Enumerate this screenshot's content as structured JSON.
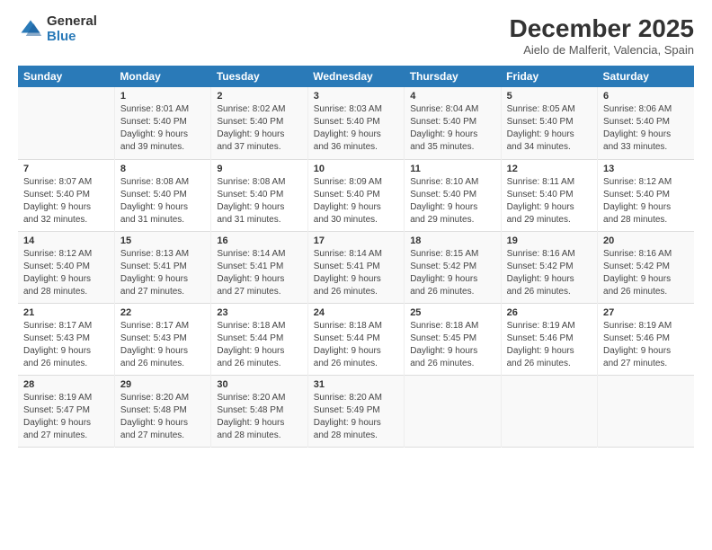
{
  "logo": {
    "general": "General",
    "blue": "Blue"
  },
  "title": "December 2025",
  "subtitle": "Aielo de Malferit, Valencia, Spain",
  "days_header": [
    "Sunday",
    "Monday",
    "Tuesday",
    "Wednesday",
    "Thursday",
    "Friday",
    "Saturday"
  ],
  "weeks": [
    [
      {
        "num": "",
        "info": ""
      },
      {
        "num": "1",
        "info": "Sunrise: 8:01 AM\nSunset: 5:40 PM\nDaylight: 9 hours\nand 39 minutes."
      },
      {
        "num": "2",
        "info": "Sunrise: 8:02 AM\nSunset: 5:40 PM\nDaylight: 9 hours\nand 37 minutes."
      },
      {
        "num": "3",
        "info": "Sunrise: 8:03 AM\nSunset: 5:40 PM\nDaylight: 9 hours\nand 36 minutes."
      },
      {
        "num": "4",
        "info": "Sunrise: 8:04 AM\nSunset: 5:40 PM\nDaylight: 9 hours\nand 35 minutes."
      },
      {
        "num": "5",
        "info": "Sunrise: 8:05 AM\nSunset: 5:40 PM\nDaylight: 9 hours\nand 34 minutes."
      },
      {
        "num": "6",
        "info": "Sunrise: 8:06 AM\nSunset: 5:40 PM\nDaylight: 9 hours\nand 33 minutes."
      }
    ],
    [
      {
        "num": "7",
        "info": "Sunrise: 8:07 AM\nSunset: 5:40 PM\nDaylight: 9 hours\nand 32 minutes."
      },
      {
        "num": "8",
        "info": "Sunrise: 8:08 AM\nSunset: 5:40 PM\nDaylight: 9 hours\nand 31 minutes."
      },
      {
        "num": "9",
        "info": "Sunrise: 8:08 AM\nSunset: 5:40 PM\nDaylight: 9 hours\nand 31 minutes."
      },
      {
        "num": "10",
        "info": "Sunrise: 8:09 AM\nSunset: 5:40 PM\nDaylight: 9 hours\nand 30 minutes."
      },
      {
        "num": "11",
        "info": "Sunrise: 8:10 AM\nSunset: 5:40 PM\nDaylight: 9 hours\nand 29 minutes."
      },
      {
        "num": "12",
        "info": "Sunrise: 8:11 AM\nSunset: 5:40 PM\nDaylight: 9 hours\nand 29 minutes."
      },
      {
        "num": "13",
        "info": "Sunrise: 8:12 AM\nSunset: 5:40 PM\nDaylight: 9 hours\nand 28 minutes."
      }
    ],
    [
      {
        "num": "14",
        "info": "Sunrise: 8:12 AM\nSunset: 5:40 PM\nDaylight: 9 hours\nand 28 minutes."
      },
      {
        "num": "15",
        "info": "Sunrise: 8:13 AM\nSunset: 5:41 PM\nDaylight: 9 hours\nand 27 minutes."
      },
      {
        "num": "16",
        "info": "Sunrise: 8:14 AM\nSunset: 5:41 PM\nDaylight: 9 hours\nand 27 minutes."
      },
      {
        "num": "17",
        "info": "Sunrise: 8:14 AM\nSunset: 5:41 PM\nDaylight: 9 hours\nand 26 minutes."
      },
      {
        "num": "18",
        "info": "Sunrise: 8:15 AM\nSunset: 5:42 PM\nDaylight: 9 hours\nand 26 minutes."
      },
      {
        "num": "19",
        "info": "Sunrise: 8:16 AM\nSunset: 5:42 PM\nDaylight: 9 hours\nand 26 minutes."
      },
      {
        "num": "20",
        "info": "Sunrise: 8:16 AM\nSunset: 5:42 PM\nDaylight: 9 hours\nand 26 minutes."
      }
    ],
    [
      {
        "num": "21",
        "info": "Sunrise: 8:17 AM\nSunset: 5:43 PM\nDaylight: 9 hours\nand 26 minutes."
      },
      {
        "num": "22",
        "info": "Sunrise: 8:17 AM\nSunset: 5:43 PM\nDaylight: 9 hours\nand 26 minutes."
      },
      {
        "num": "23",
        "info": "Sunrise: 8:18 AM\nSunset: 5:44 PM\nDaylight: 9 hours\nand 26 minutes."
      },
      {
        "num": "24",
        "info": "Sunrise: 8:18 AM\nSunset: 5:44 PM\nDaylight: 9 hours\nand 26 minutes."
      },
      {
        "num": "25",
        "info": "Sunrise: 8:18 AM\nSunset: 5:45 PM\nDaylight: 9 hours\nand 26 minutes."
      },
      {
        "num": "26",
        "info": "Sunrise: 8:19 AM\nSunset: 5:46 PM\nDaylight: 9 hours\nand 26 minutes."
      },
      {
        "num": "27",
        "info": "Sunrise: 8:19 AM\nSunset: 5:46 PM\nDaylight: 9 hours\nand 27 minutes."
      }
    ],
    [
      {
        "num": "28",
        "info": "Sunrise: 8:19 AM\nSunset: 5:47 PM\nDaylight: 9 hours\nand 27 minutes."
      },
      {
        "num": "29",
        "info": "Sunrise: 8:20 AM\nSunset: 5:48 PM\nDaylight: 9 hours\nand 27 minutes."
      },
      {
        "num": "30",
        "info": "Sunrise: 8:20 AM\nSunset: 5:48 PM\nDaylight: 9 hours\nand 28 minutes."
      },
      {
        "num": "31",
        "info": "Sunrise: 8:20 AM\nSunset: 5:49 PM\nDaylight: 9 hours\nand 28 minutes."
      },
      {
        "num": "",
        "info": ""
      },
      {
        "num": "",
        "info": ""
      },
      {
        "num": "",
        "info": ""
      }
    ]
  ]
}
